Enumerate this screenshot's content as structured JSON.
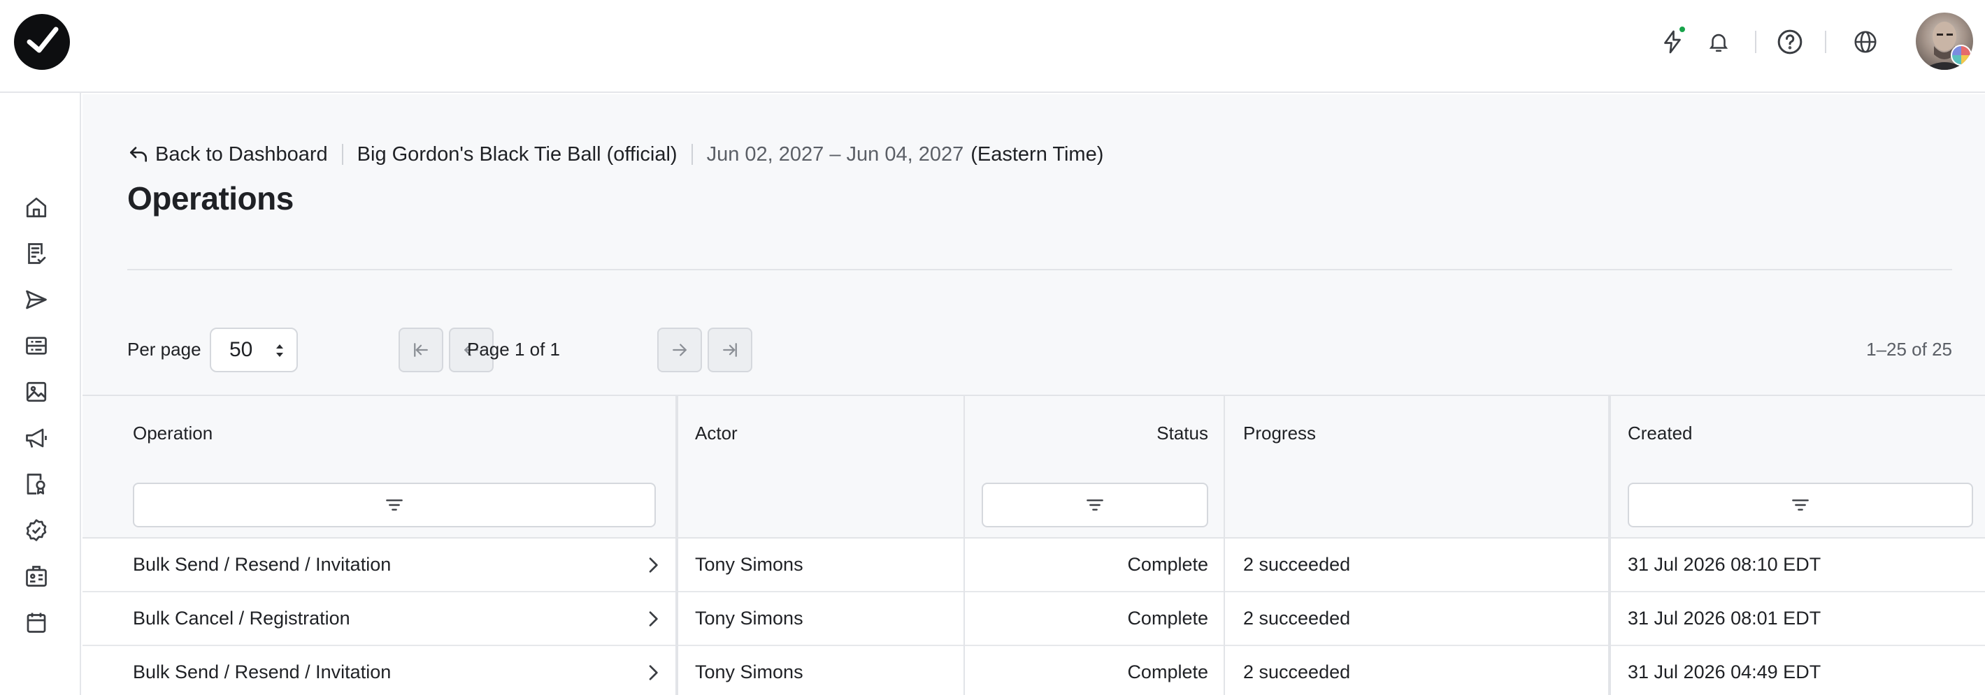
{
  "breadcrumb": {
    "back_label": "Back to Dashboard",
    "event_name": "Big Gordon's Black Tie Ball (official)",
    "dates": "Jun 02, 2027 – Jun 04, 2027",
    "timezone": "(Eastern Time)"
  },
  "page_title": "Operations",
  "pagination": {
    "per_page_label": "Per page",
    "per_page_value": "50",
    "page_text": "Page 1 of 1",
    "range_text": "1–25 of 25"
  },
  "table": {
    "columns": {
      "operation": "Operation",
      "actor": "Actor",
      "status": "Status",
      "progress": "Progress",
      "created": "Created"
    },
    "rows": [
      {
        "operation": "Bulk Send / Resend / Invitation",
        "actor": "Tony Simons",
        "status": "Complete",
        "progress": "2 succeeded",
        "created": "31 Jul 2026 08:10 EDT"
      },
      {
        "operation": "Bulk Cancel / Registration",
        "actor": "Tony Simons",
        "status": "Complete",
        "progress": "2 succeeded",
        "created": "31 Jul 2026 08:01 EDT"
      },
      {
        "operation": "Bulk Send / Resend / Invitation",
        "actor": "Tony Simons",
        "status": "Complete",
        "progress": "2 succeeded",
        "created": "31 Jul 2026 04:49 EDT"
      }
    ]
  },
  "icons": {
    "top": [
      "bolt-icon",
      "bell-icon",
      "help-icon",
      "globe-icon"
    ],
    "sidebar": [
      "home-icon",
      "checklist-icon",
      "send-icon",
      "list-icon",
      "image-icon",
      "megaphone-icon",
      "badge-icon",
      "check-circle-icon",
      "id-card-icon",
      "calendar-icon"
    ]
  },
  "colors": {
    "accent_dot": "#17a34a",
    "background": "#f7f8fa",
    "text": "#1f2125"
  }
}
